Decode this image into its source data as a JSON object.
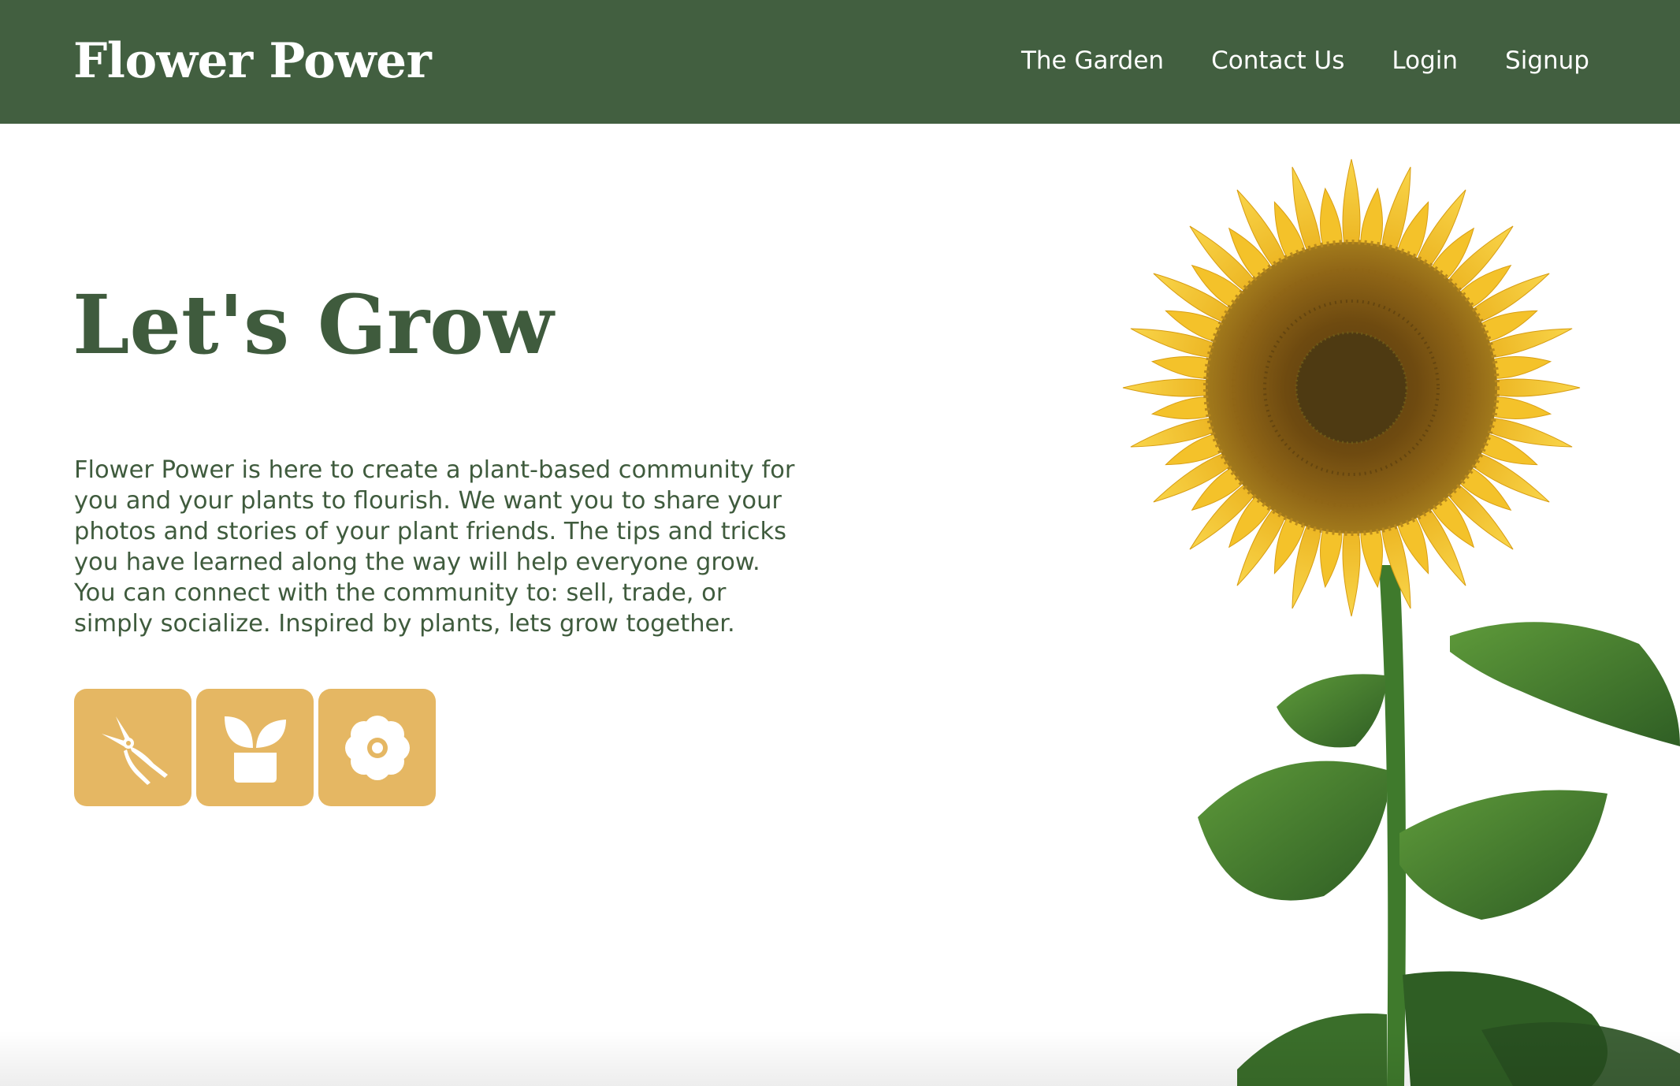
{
  "header": {
    "brand": "Flower Power",
    "nav": [
      {
        "label": "The Garden"
      },
      {
        "label": "Contact Us"
      },
      {
        "label": "Login"
      },
      {
        "label": "Signup"
      }
    ]
  },
  "hero": {
    "title": "Let's Grow",
    "description": "Flower Power is here to create a plant-based community for you and your plants to flourish. We want you to share your photos and stories of your plant friends. The tips and tricks you have learned along the way will help everyone grow. You can connect with the community to: sell, trade, or simply socialize. Inspired by plants, lets grow together."
  },
  "tiles": [
    {
      "icon": "pruning-shears-icon"
    },
    {
      "icon": "potted-plant-icon"
    },
    {
      "icon": "flower-icon"
    }
  ],
  "colors": {
    "header_bg": "#425f40",
    "heading_text": "#3f5b3d",
    "tile_bg": "#e5b763",
    "petal_yellow": "#f6c52a",
    "seed_brown": "#7a5514",
    "leaf_green": "#3f7a2c"
  },
  "image": {
    "subject": "sunflower"
  }
}
